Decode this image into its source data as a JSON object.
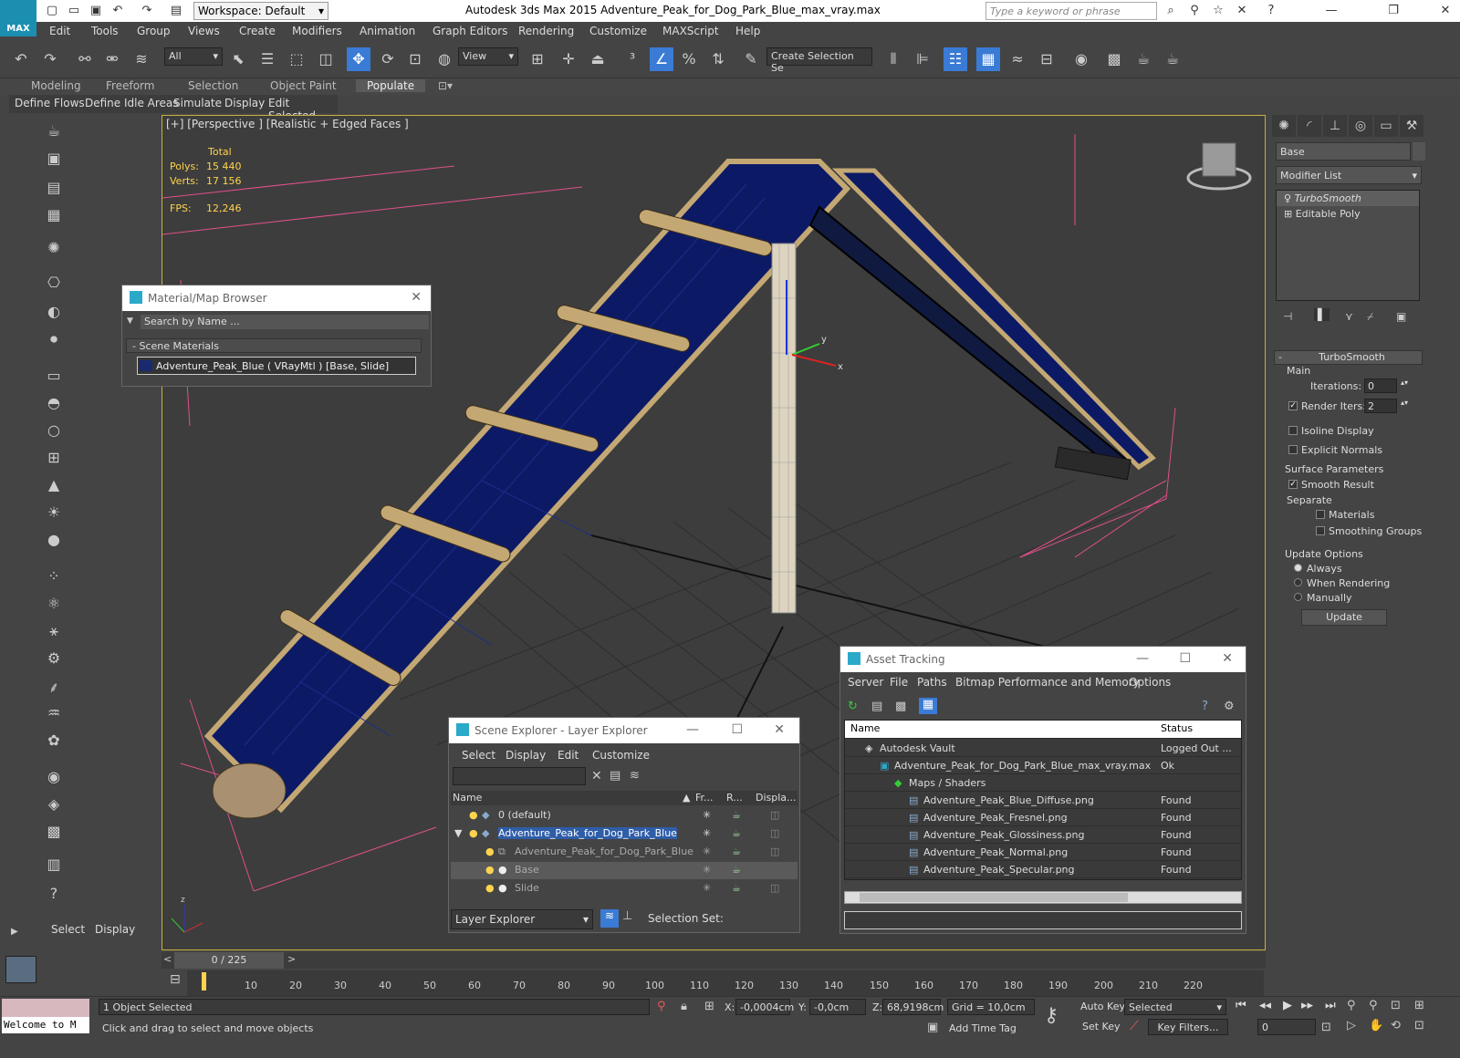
{
  "window": {
    "title": "Autodesk 3ds Max  2015     Adventure_Peak_for_Dog_Park_Blue_max_vray.max",
    "app_badge": "MAX",
    "workspace": "Workspace: Default",
    "search_placeholder": "Type a keyword or phrase"
  },
  "menu": [
    "Edit",
    "Tools",
    "Group",
    "Views",
    "Create",
    "Modifiers",
    "Animation",
    "Graph Editors",
    "Rendering",
    "Customize",
    "MAXScript",
    "Help"
  ],
  "toolbar": {
    "filter_select": "All",
    "view_select": "View",
    "named_selection_placeholder": "Create Selection Se"
  },
  "ribbon": {
    "tabs": [
      "Modeling",
      "Freeform",
      "Selection",
      "Object Paint",
      "Populate"
    ],
    "active_tab": "Populate",
    "sub_items": [
      "Define Flows",
      "Define Idle Areas",
      "Simulate",
      "Display",
      "Edit Selected"
    ]
  },
  "viewport": {
    "label": "[+] [Perspective ] [Realistic + Edged Faces ]",
    "stats_header": "Total",
    "polys_label": "Polys:",
    "polys_value": "15 440",
    "verts_label": "Verts:",
    "verts_value": "17 156",
    "fps_label": "FPS:",
    "fps_value": "12,246"
  },
  "material_browser": {
    "title": "Material/Map Browser",
    "search_placeholder": "Search by Name ...",
    "group": "Scene Materials",
    "item": "Adventure_Peak_Blue  ( VRayMtl ) [Base, Slide]"
  },
  "command_panel": {
    "object_name": "Base",
    "modifier_list": "Modifier List",
    "stack": [
      "TurboSmooth",
      "Editable Poly"
    ],
    "rollout_title": "TurboSmooth",
    "main_label": "Main",
    "iterations_label": "Iterations:",
    "iterations_value": "0",
    "render_iters_label": "Render Iters:",
    "render_iters_value": "2",
    "isoline_label": "Isoline Display",
    "explicit_label": "Explicit Normals",
    "surface_label": "Surface Parameters",
    "smooth_label": "Smooth Result",
    "separate_label": "Separate",
    "materials_label": "Materials",
    "smoothing_groups_label": "Smoothing Groups",
    "update_options_label": "Update Options",
    "always_label": "Always",
    "when_rendering_label": "When Rendering",
    "manually_label": "Manually",
    "update_button": "Update"
  },
  "scene_explorer": {
    "title": "Scene Explorer - Layer Explorer",
    "menu": [
      "Select",
      "Display",
      "Edit",
      "Customize"
    ],
    "columns": [
      "Name",
      "Fr...",
      "R...",
      "Displa..."
    ],
    "rows": [
      {
        "name": "0 (default)"
      },
      {
        "name": "Adventure_Peak_for_Dog_Park_Blue"
      },
      {
        "name": "Adventure_Peak_for_Dog_Park_Blue"
      },
      {
        "name": "Base"
      },
      {
        "name": "Slide"
      }
    ],
    "footer_select": "Layer Explorer",
    "selection_set_label": "Selection Set:"
  },
  "asset_tracking": {
    "title": "Asset Tracking",
    "menu": [
      "Server",
      "File",
      "Paths",
      "Bitmap Performance and Memory",
      "Options"
    ],
    "columns": [
      "Name",
      "Status"
    ],
    "rows": [
      {
        "name": "Autodesk Vault",
        "status": "Logged Out ..."
      },
      {
        "name": "Adventure_Peak_for_Dog_Park_Blue_max_vray.max",
        "status": "Ok"
      },
      {
        "name": "Maps / Shaders",
        "status": ""
      },
      {
        "name": "Adventure_Peak_Blue_Diffuse.png",
        "status": "Found"
      },
      {
        "name": "Adventure_Peak_Fresnel.png",
        "status": "Found"
      },
      {
        "name": "Adventure_Peak_Glossiness.png",
        "status": "Found"
      },
      {
        "name": "Adventure_Peak_Normal.png",
        "status": "Found"
      },
      {
        "name": "Adventure_Peak_Specular.png",
        "status": "Found"
      }
    ]
  },
  "timeline": {
    "frame": "0 / 225",
    "ticks": [
      "10",
      "20",
      "30",
      "40",
      "50",
      "60",
      "70",
      "80",
      "90",
      "100",
      "110",
      "120",
      "130",
      "140",
      "150",
      "160",
      "170",
      "180",
      "190",
      "200",
      "210",
      "220"
    ]
  },
  "left_panel": {
    "select_tab": "Select",
    "display_tab": "Display"
  },
  "status": {
    "maxscript": "Welcome to M",
    "selected": "1 Object Selected",
    "prompt": "Click and drag to select and move objects",
    "x_label": "X:",
    "x_value": "-0,0004cm",
    "y_label": "Y:",
    "y_value": "-0,0cm",
    "z_label": "Z:",
    "z_value": "68,9198cm",
    "grid": "Grid = 10,0cm",
    "auto_key": "Auto Key",
    "set_key": "Set Key",
    "selected_select": "Selected",
    "key_filters": "Key Filters...",
    "add_time_tag": "Add Time Tag",
    "frame_value": "0"
  }
}
